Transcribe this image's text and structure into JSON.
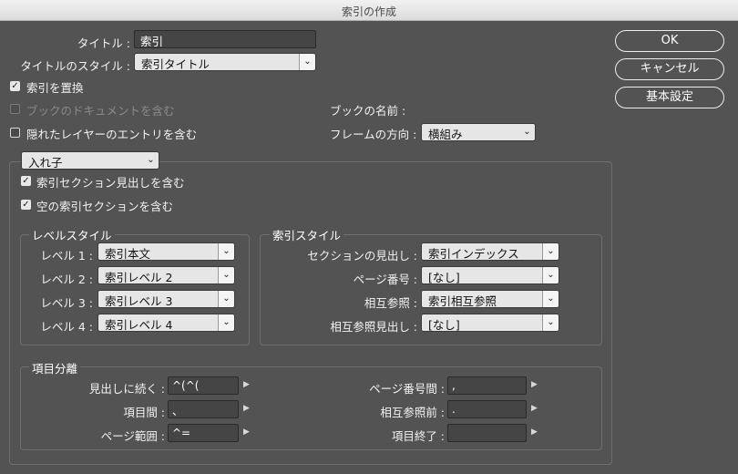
{
  "window": {
    "title": "索引の作成"
  },
  "top": {
    "title_label": "タイトル :",
    "title_value": "索引",
    "title_style_label": "タイトルのスタイル :",
    "title_style_value": "索引タイトル",
    "replace_label": "索引を置換",
    "replace_checked": true,
    "book_docs_label": "ブックのドキュメントを含む",
    "book_docs_enabled": false,
    "hidden_layers_label": "隠れたレイヤーのエントリを含む",
    "hidden_layers_checked": false,
    "book_name_label": "ブックの名前 :",
    "frame_direction_label": "フレームの方向 :",
    "frame_direction_value": "横組み"
  },
  "buttons": {
    "ok": "OK",
    "cancel": "キャンセル",
    "basic": "基本設定"
  },
  "nested": {
    "type_value": "入れ子",
    "include_section_headings": "索引セクション見出しを含む",
    "include_empty_sections": "空の索引セクションを含む"
  },
  "level_style": {
    "legend": "レベルスタイル",
    "rows": [
      {
        "label": "レベル 1 :",
        "value": "索引本文"
      },
      {
        "label": "レベル 2 :",
        "value": "索引レベル 2"
      },
      {
        "label": "レベル 3 :",
        "value": "索引レベル 3"
      },
      {
        "label": "レベル 4 :",
        "value": "索引レベル 4"
      }
    ]
  },
  "index_style": {
    "legend": "索引スタイル",
    "rows": [
      {
        "label": "セクションの見出し :",
        "value": "索引インデックス"
      },
      {
        "label": "ページ番号 :",
        "value": "[なし]"
      },
      {
        "label": "相互参照 :",
        "value": "索引相互参照"
      },
      {
        "label": "相互参照見出し :",
        "value": "[なし]"
      }
    ]
  },
  "separators": {
    "legend": "項目分離",
    "left": [
      {
        "label": "見出しに続く :",
        "value": "^(^("
      },
      {
        "label": "項目間 :",
        "value": "、"
      },
      {
        "label": "ページ範囲 :",
        "value": "^="
      }
    ],
    "right": [
      {
        "label": "ページ番号間 :",
        "value": ","
      },
      {
        "label": "相互参照前 :",
        "value": "."
      },
      {
        "label": "項目終了 :",
        "value": ""
      }
    ]
  },
  "icons": {
    "dropdown": "chevron-down-icon",
    "popup": "triangle-right-icon",
    "checkbox": "checkmark-icon"
  }
}
